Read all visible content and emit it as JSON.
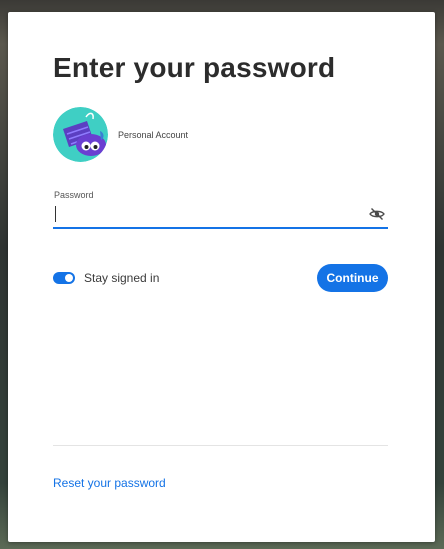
{
  "title": "Enter your password",
  "account": {
    "name": "Personal Account",
    "avatar_icon": "cartoon-avatar-icon"
  },
  "password": {
    "label": "Password",
    "value": "",
    "show_icon": "eye-off-icon"
  },
  "stay_signed_in": {
    "label": "Stay signed in",
    "checked": true
  },
  "continue_label": "Continue",
  "reset_link": "Reset your password",
  "colors": {
    "accent": "#1473e6",
    "title": "#2c2c2c"
  }
}
